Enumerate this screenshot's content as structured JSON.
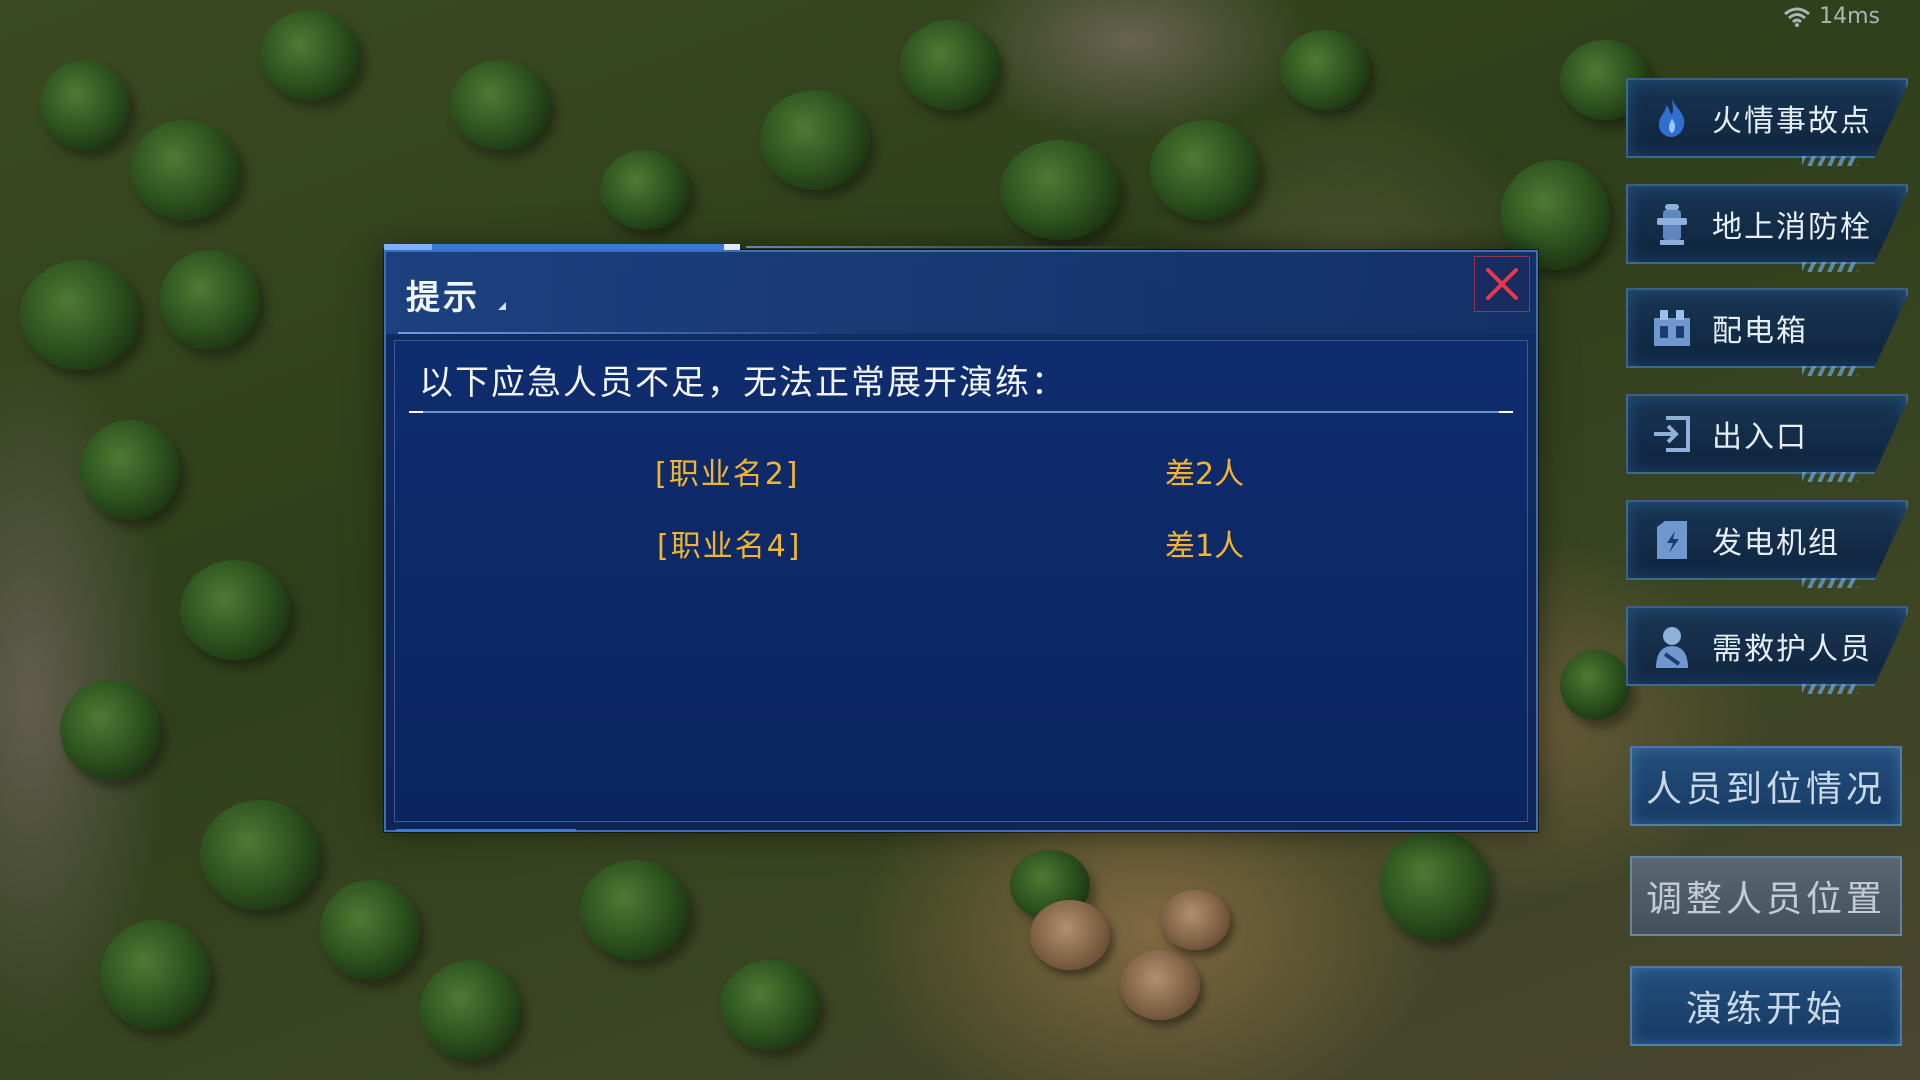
{
  "status": {
    "ping": "14ms"
  },
  "legend": {
    "items": [
      {
        "label": "火情事故点",
        "icon": "flame-icon"
      },
      {
        "label": "地上消防栓",
        "icon": "fire-hydrant-icon"
      },
      {
        "label": "配电箱",
        "icon": "distribution-box-icon"
      },
      {
        "label": "出入口",
        "icon": "entrance-icon"
      },
      {
        "label": "发电机组",
        "icon": "generator-icon"
      },
      {
        "label": "需救护人员",
        "icon": "injured-person-icon"
      }
    ]
  },
  "actions": {
    "personnel_status": "人员到位情况",
    "adjust_positions": "调整人员位置",
    "start_drill": "演练开始"
  },
  "dialog": {
    "title": "提示",
    "message": "以下应急人员不足，无法正常展开演练：",
    "rows": [
      {
        "role": "[职业名2]",
        "need": "差2人"
      },
      {
        "role": "[职业名4]",
        "need": "差1人"
      }
    ]
  },
  "colors": {
    "accent_yellow": "#f1b530",
    "dialog_bg": "#0f2c6e",
    "close_red": "#e8384a"
  }
}
